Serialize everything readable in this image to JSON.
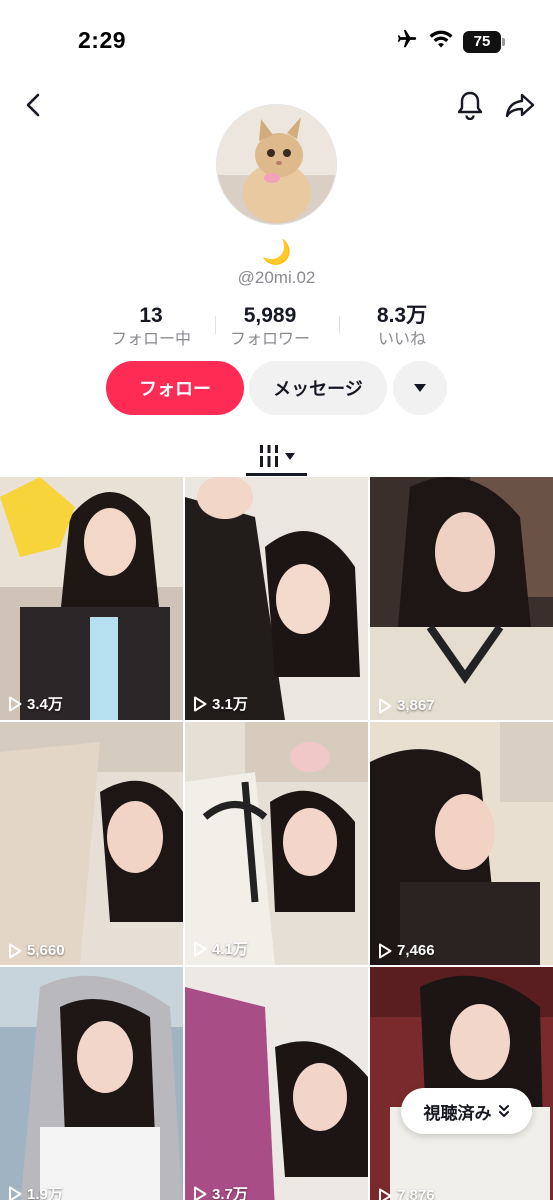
{
  "status_bar": {
    "time": "2:29",
    "battery": "75",
    "icons": [
      "airplane-icon",
      "wifi-icon",
      "battery-icon"
    ]
  },
  "nav": {
    "icons": [
      "back-chevron-icon",
      "bell-icon",
      "share-icon"
    ]
  },
  "profile": {
    "display_name": "🌙",
    "username": "@20mi.02"
  },
  "stats": {
    "following": {
      "value": "13",
      "label": "フォロー中"
    },
    "followers": {
      "value": "5,989",
      "label": "フォロワー"
    },
    "likes": {
      "value": "8.3万",
      "label": "いいね"
    }
  },
  "actions": {
    "follow_label": "フォロー",
    "message_label": "メッセージ",
    "more_icon": "caret-down-icon"
  },
  "tabs": {
    "videos_icon": "videos-grid-icon"
  },
  "videos": [
    {
      "views": "3.4万"
    },
    {
      "views": "3.1万"
    },
    {
      "views": "3,867"
    },
    {
      "views": "5,660"
    },
    {
      "views": "4.1万"
    },
    {
      "views": "7,466"
    },
    {
      "views": "1.9万"
    },
    {
      "views": "3.7万"
    },
    {
      "views": "7,876"
    }
  ],
  "watched_button": {
    "label": "視聴済み",
    "icon": "double-chevron-down-icon"
  },
  "colors": {
    "accent": "#fe2c55",
    "secondary_button": "#f1f1f2",
    "muted_text": "#8a8b91"
  }
}
